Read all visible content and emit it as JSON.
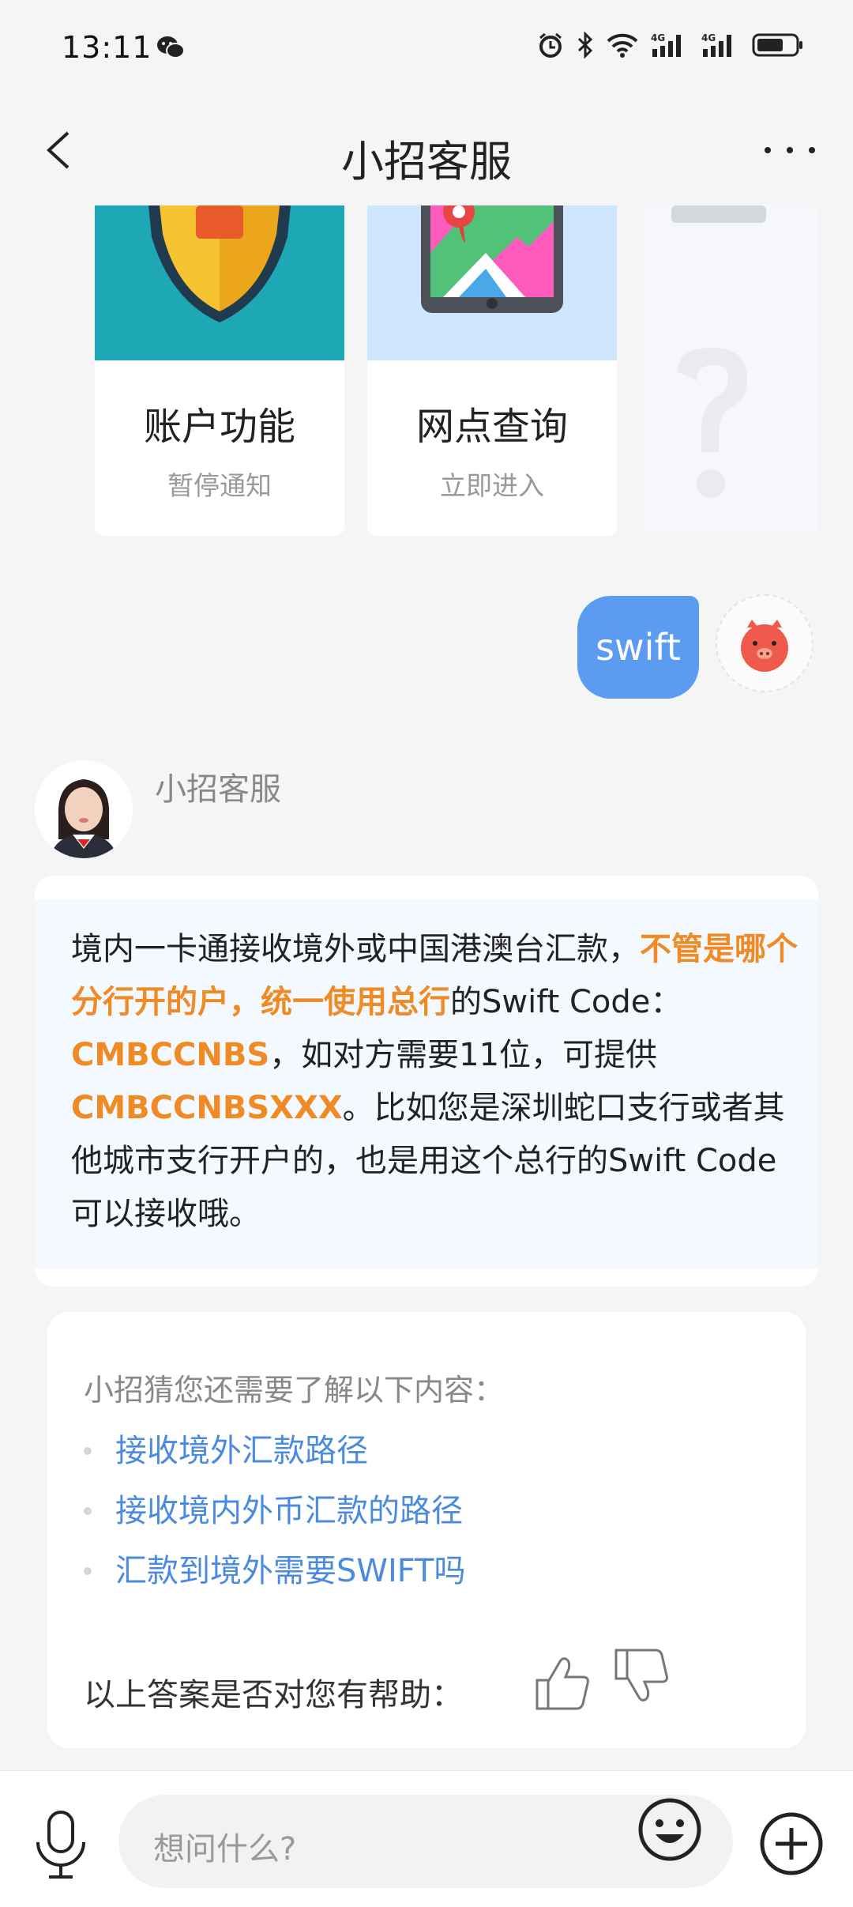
{
  "status_bar": {
    "time": "13:11",
    "battery_level": 0.7
  },
  "header": {
    "title": "小招客服"
  },
  "cards": [
    {
      "title": "账户功能",
      "subtitle": "暂停通知",
      "art_color": "#1ea8b5"
    },
    {
      "title": "网点查询",
      "subtitle": "立即进入",
      "art_color": "#cfe6ff"
    },
    {
      "title": "",
      "subtitle": "",
      "art_color": "#f6f7fa"
    }
  ],
  "user_message": {
    "text": "swift"
  },
  "bot": {
    "name": "小招客服",
    "answer": [
      {
        "text": "境内一卡通接收境外或中国港澳台汇款，",
        "highlight": false
      },
      {
        "text": "不管是哪个分行开的户，统一使用总行",
        "highlight": true
      },
      {
        "text": "的Swift Code：",
        "highlight": false
      },
      {
        "text": "CMBCCNBS",
        "highlight": true
      },
      {
        "text": "，如对方需要11位，可提供",
        "highlight": false
      },
      {
        "text": "CMBCCNBSXXX",
        "highlight": true
      },
      {
        "text": "。比如您是深圳蛇口支行或者其他城市支行开户的，也是用这个总行的Swift Code可以接收哦。",
        "highlight": false
      }
    ]
  },
  "suggestions": {
    "title": "小招猜您还需要了解以下内容：",
    "items": [
      "接收境外汇款路径",
      "接收境内外币汇款的路径",
      "汇款到境外需要SWIFT吗"
    ],
    "feedback_question": "以上答案是否对您有帮助："
  },
  "input": {
    "placeholder": "想问什么?"
  },
  "colors": {
    "accent": "#5b9bf0",
    "highlight": "#f08a24",
    "link": "#4a8be0"
  }
}
